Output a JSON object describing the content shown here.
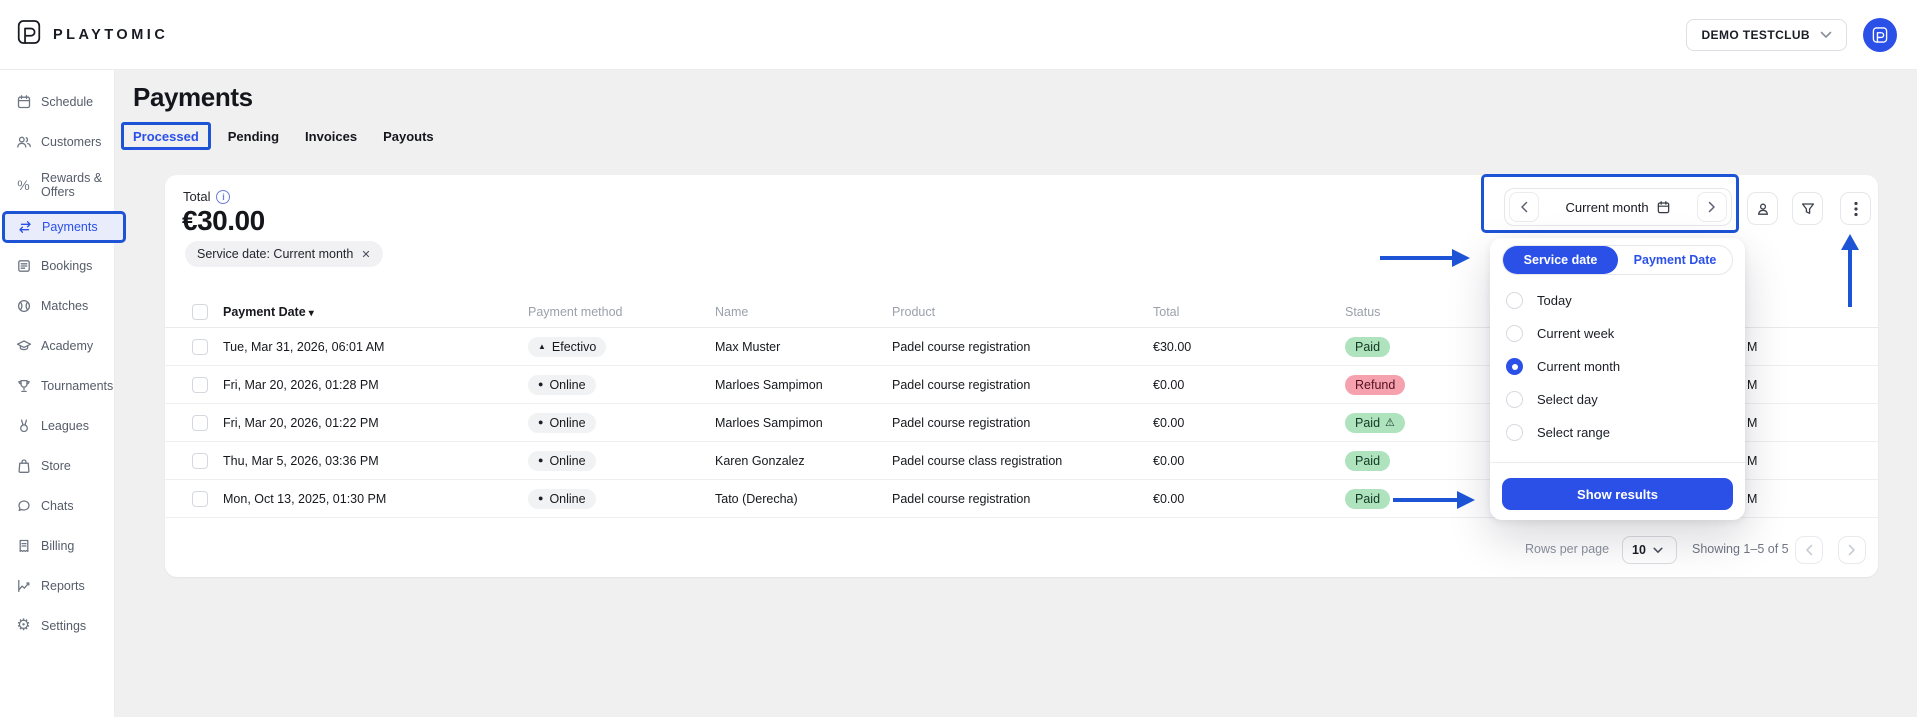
{
  "colors": {
    "accent_blue": "#2b50e8",
    "annotation_blue": "#1d54d6",
    "paid_badge_bg": "#aee3bd",
    "refund_badge_bg": "#f6a2ae",
    "active_sidebar_bg": "#e9edfb"
  },
  "icons": {
    "close": "✕",
    "sort_desc": "▾",
    "warning": "⚠",
    "info": "i",
    "percent": "%",
    "gear": "⚙"
  },
  "topbar": {
    "brand": "PLAYTOMIC",
    "club_button_label": "DEMO TESTCLUB"
  },
  "sidebar": {
    "items": [
      "Schedule",
      "Customers",
      "Rewards & Offers",
      "Payments",
      "Bookings",
      "Matches",
      "Academy",
      "Tournaments",
      "Leagues",
      "Store",
      "Chats",
      "Billing",
      "Reports",
      "Settings"
    ]
  },
  "page": {
    "title": "Payments",
    "tabs": {
      "processed": "Processed",
      "pending": "Pending",
      "invoices": "Invoices",
      "payouts": "Payouts"
    },
    "active_tab": "Processed"
  },
  "summary": {
    "total_label": "Total",
    "total_value": "€30.00",
    "filter_chip_label": "Service date: Current month"
  },
  "datebar": {
    "range_label": "Current month"
  },
  "popover": {
    "tab_service": "Service date",
    "tab_payment": "Payment Date",
    "active_tab": "Service date",
    "options": [
      "Today",
      "Current week",
      "Current month",
      "Select day",
      "Select range"
    ],
    "selected_option": "Current month",
    "submit_label": "Show results"
  },
  "table": {
    "columns": [
      "Payment Date",
      "Payment method",
      "Name",
      "Product",
      "Total",
      "Status"
    ],
    "rows": [
      {
        "date": "Tue, Mar 31, 2026, 06:01 AM",
        "method": "Efectivo",
        "method_icon": "▲",
        "name": "Max Muster",
        "product": "Padel course registration",
        "total": "€30.00",
        "status": "Paid",
        "fragment": "M"
      },
      {
        "date": "Fri, Mar 20, 2026, 01:28 PM",
        "method": "Online",
        "method_icon": "●",
        "name": "Marloes Sampimon",
        "product": "Padel course registration",
        "total": "€0.00",
        "status": "Refund",
        "fragment": "M"
      },
      {
        "date": "Fri, Mar 20, 2026, 01:22 PM",
        "method": "Online",
        "method_icon": "●",
        "name": "Marloes Sampimon",
        "product": "Padel course registration",
        "total": "€0.00",
        "status": "Paid",
        "status_warning": "⚠",
        "fragment": "M"
      },
      {
        "date": "Thu, Mar 5, 2026, 03:36 PM",
        "method": "Online",
        "method_icon": "●",
        "name": "Karen Gonzalez",
        "product": "Padel course class registration",
        "total": "€0.00",
        "status": "Paid",
        "fragment": "M"
      },
      {
        "date": "Mon, Oct 13, 2025, 01:30 PM",
        "method": "Online",
        "method_icon": "●",
        "name": "Tato (Derecha)",
        "product": "Padel course registration",
        "total": "€0.00",
        "status": "Paid",
        "fragment": "M"
      }
    ]
  },
  "pagination": {
    "rows_per_page_label": "Rows per page",
    "rows_per_page_value": "10",
    "showing_label": "Showing 1–5 of 5"
  }
}
